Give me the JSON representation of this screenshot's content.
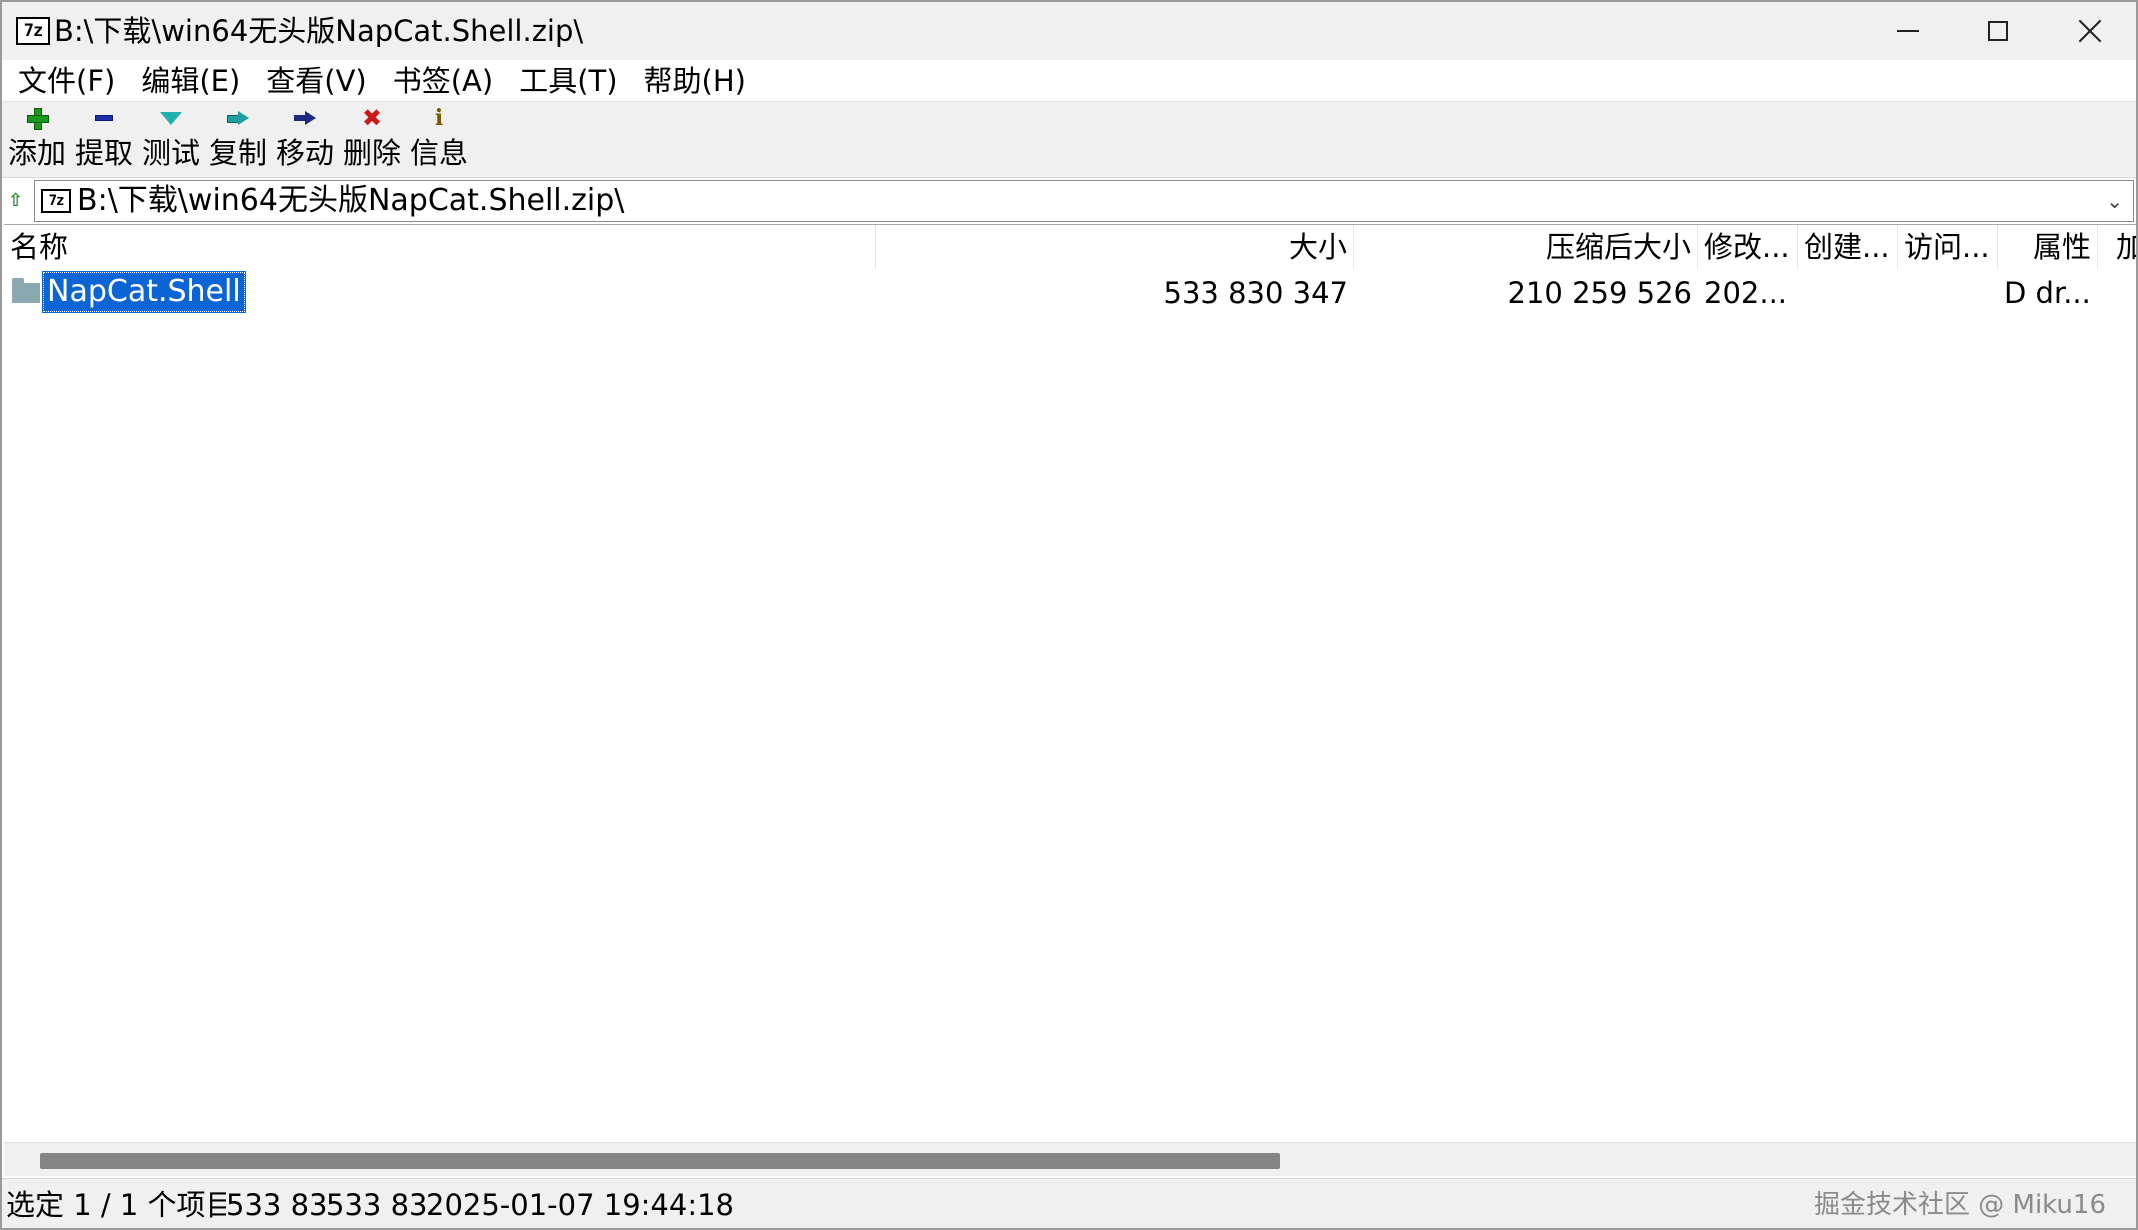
{
  "window": {
    "app_icon_text": "7z",
    "title": "B:\\下载\\win64无头版NapCat.Shell.zip\\"
  },
  "menu": [
    {
      "label": "文件(F)"
    },
    {
      "label": "编辑(E)"
    },
    {
      "label": "查看(V)"
    },
    {
      "label": "书签(A)"
    },
    {
      "label": "工具(T)"
    },
    {
      "label": "帮助(H)"
    }
  ],
  "toolbar": {
    "add": {
      "label": "添加",
      "icon": "plus-icon",
      "color": "#1a9a1a"
    },
    "extract": {
      "label": "提取",
      "icon": "minus-icon",
      "color": "#1c2fa8"
    },
    "test": {
      "label": "测试",
      "icon": "check-icon",
      "color": "#20b0b0"
    },
    "copy": {
      "label": "复制",
      "icon": "arrow-right-icon",
      "color": "#20a0a0"
    },
    "move": {
      "label": "移动",
      "icon": "arrow-right-icon",
      "color": "#1c2a80"
    },
    "delete": {
      "label": "删除",
      "icon": "x-icon",
      "glyph": "✖",
      "color": "#d01818"
    },
    "info": {
      "label": "信息",
      "icon": "info-icon",
      "glyph": "i",
      "color": "#7a5a00"
    }
  },
  "address": {
    "up_glyph": "⇧",
    "icon_text": "7z",
    "path": "B:\\下载\\win64无头版NapCat.Shell.zip\\",
    "dropdown_glyph": "⌄"
  },
  "columns": {
    "name": "名称",
    "size": "大小",
    "packed": "压缩后大小",
    "modified": "修改...",
    "created": "创建...",
    "accessed": "访问...",
    "attributes": "属性",
    "more": "加"
  },
  "rows": [
    {
      "name": "NapCat.Shell",
      "size": "533 830 347",
      "packed": "210 259 526",
      "modified": "202...",
      "created": "",
      "accessed": "",
      "attributes": "D dr..."
    }
  ],
  "status": {
    "selection": "选定 1 / 1 个项目",
    "size": "533 830 347",
    "packed": "533 830 347",
    "modified": "2025-01-07 19:44:18"
  },
  "watermark": "掘金技术社区 @ Miku16",
  "colors": {
    "selection_bg": "#0a64d4",
    "chrome_bg": "#f0f0f0",
    "folder": "#8aa8b0"
  }
}
